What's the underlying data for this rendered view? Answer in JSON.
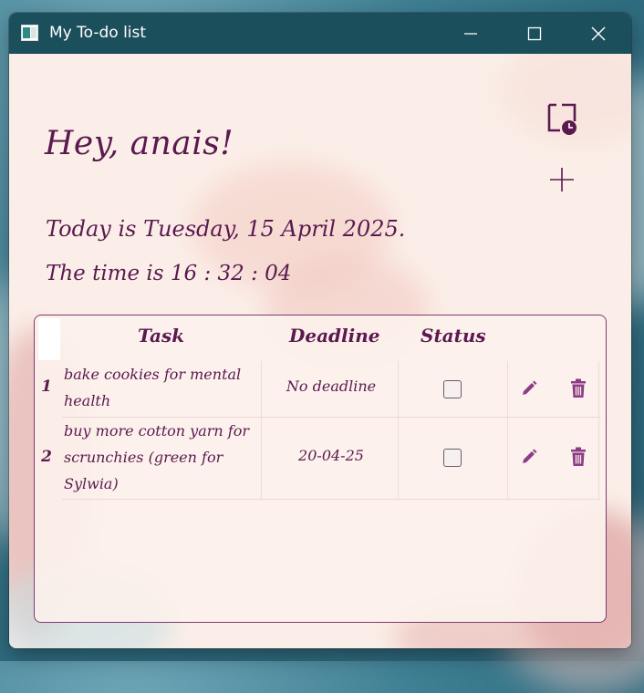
{
  "window": {
    "title": "My To-do list"
  },
  "header": {
    "greeting": "Hey, anais!",
    "date_text": "Today is Tuesday, 15 April 2025.",
    "time_text": "The time is 16 : 32 : 04"
  },
  "actions": {
    "history_icon": "folder-clock-icon",
    "add_icon": "plus-icon"
  },
  "table": {
    "columns": [
      "Task",
      "Deadline",
      "Status"
    ],
    "rows": [
      {
        "num": "1",
        "task": "bake cookies for mental health",
        "deadline": "No deadline",
        "done": false
      },
      {
        "num": "2",
        "task": "buy more cotton yarn for scrunchies (green for Sylwia)",
        "deadline": "20-04-25",
        "done": false
      }
    ]
  },
  "colors": {
    "accent": "#5a1a4f",
    "icon_purple": "#8b3d86",
    "titlebar": "#1c4f5c"
  }
}
